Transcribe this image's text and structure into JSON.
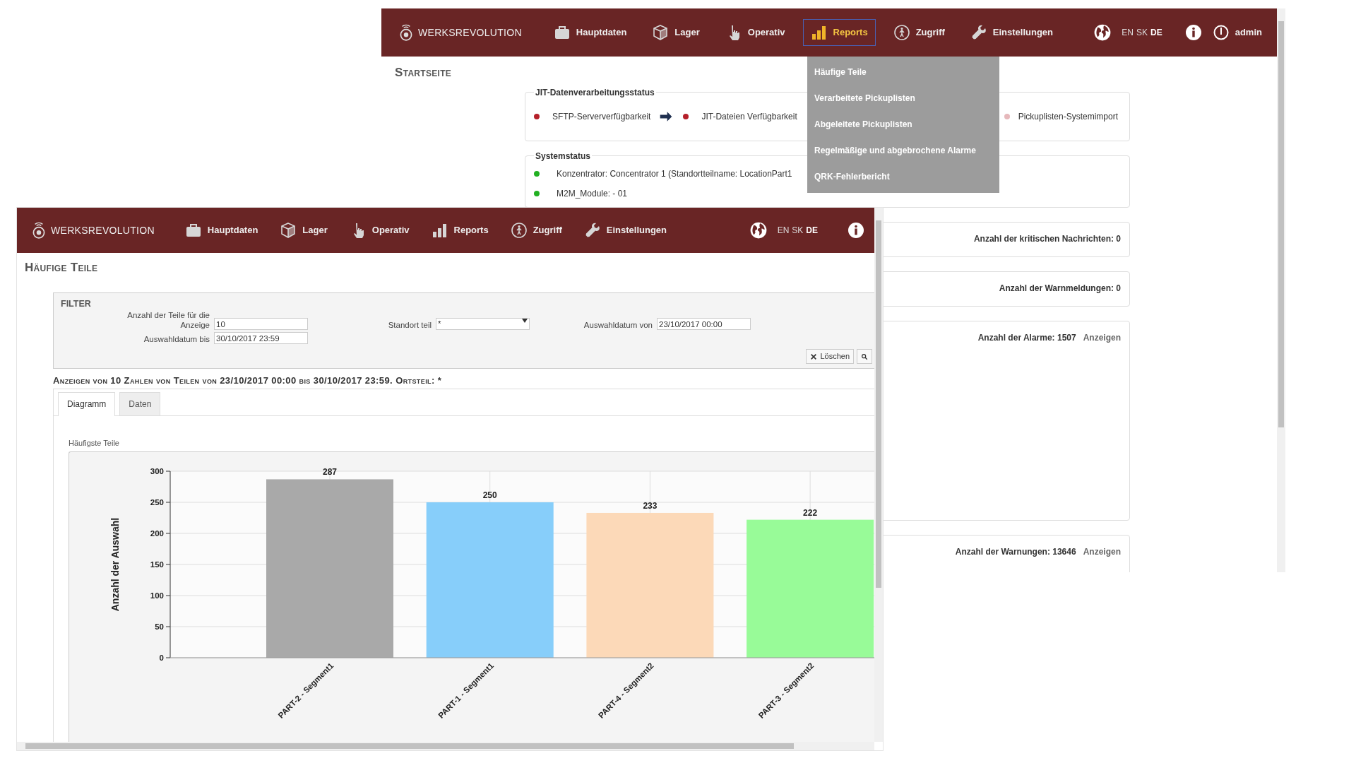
{
  "back_window": {
    "nav": {
      "logo": "WERKSREVOLUTION",
      "items": [
        {
          "label": "Hauptdaten",
          "selected": false
        },
        {
          "label": "Lager",
          "selected": false
        },
        {
          "label": "Operativ",
          "selected": false
        },
        {
          "label": "Reports",
          "selected": true
        },
        {
          "label": "Zugriff",
          "selected": false
        },
        {
          "label": "Einstellungen",
          "selected": false
        }
      ],
      "languages": [
        {
          "label": "EN",
          "selected": false
        },
        {
          "label": "SK",
          "selected": false
        },
        {
          "label": "DE",
          "selected": true
        }
      ],
      "user": "admin"
    },
    "reports_menu": [
      "Häufige Teile",
      "Verarbeitete Pickuplisten",
      "Abgeleitete Pickuplisten",
      "Regelmäßige und abgebrochene Alarme",
      "QRK-Fehlerbericht"
    ],
    "page_title": "Startseite",
    "jit_status": {
      "title": "JIT-Datenverarbeitungsstatus",
      "steps": [
        {
          "label": "SFTP-Serververfügbarkeit",
          "color": "#b5202a"
        },
        {
          "label": "JIT-Dateien Verfügbarkeit",
          "color": "#b5202a"
        },
        {
          "label": "Pickuplisten-Systemimport",
          "color": "#e6b8bb"
        }
      ]
    },
    "system_status": {
      "title": "Systemstatus",
      "items": [
        {
          "label": "Konzentrator: Concentrator 1 (Standortteilname: LocationPart1",
          "color": "#22b022"
        },
        {
          "label": "M2M_Module: - 01",
          "color": "#22b022"
        }
      ]
    },
    "counters": [
      {
        "label": "Anzahl der kritischen Nachrichten: 0"
      },
      {
        "label": "Anzahl der Warnmeldungen: 0"
      },
      {
        "label": "Anzahl der Alarme: 1507",
        "link": "Anzeigen"
      },
      {
        "label": "Anzahl der Warnungen: 13646",
        "link": "Anzeigen"
      }
    ]
  },
  "front_window": {
    "nav": {
      "logo": "WERKSREVOLUTION",
      "items": [
        {
          "label": "Hauptdaten",
          "selected": false
        },
        {
          "label": "Lager",
          "selected": false
        },
        {
          "label": "Operativ",
          "selected": false
        },
        {
          "label": "Reports",
          "selected": false
        },
        {
          "label": "Zugriff",
          "selected": false
        },
        {
          "label": "Einstellungen",
          "selected": false
        }
      ],
      "languages": [
        {
          "label": "EN",
          "selected": false
        },
        {
          "label": "SK",
          "selected": false
        },
        {
          "label": "DE",
          "selected": true
        }
      ]
    },
    "page_title": "Häufige Teile",
    "filter": {
      "title": "FILTER",
      "fields": [
        {
          "label": "Anzahl der Teile für die Anzeige",
          "value": "10",
          "kind": "text"
        },
        {
          "label": "Standort teil",
          "value": "*",
          "kind": "select"
        },
        {
          "label": "Auswahldatum von",
          "value": "23/10/2017 00:00",
          "kind": "text"
        },
        {
          "label": "Auswahldatum bis",
          "value": "30/10/2017 23:59",
          "kind": "text"
        }
      ],
      "clear_button": "Löschen"
    },
    "summary": "Anzeigen von 10 Zahlen von Teilen von 23/10/2017 00:00 bis 30/10/2017 23:59. Ortsteil: *",
    "tabs": [
      {
        "label": "Diagramm",
        "selected": true
      },
      {
        "label": "Daten",
        "selected": false
      }
    ],
    "chart_data": {
      "type": "bar",
      "title": "Häufigste Teile",
      "ylabel": "Anzahl der Auswahl",
      "categories": [
        "PART-2 - Segment1",
        "PART-1 - Segment1",
        "PART-4 - Segment2",
        "PART-3 - Segment2"
      ],
      "series": [
        {
          "values": [
            287,
            250,
            233,
            222
          ]
        }
      ],
      "colors": [
        "#a9a9a9",
        "#87cefa",
        "#fcd9b8",
        "#98fb98"
      ],
      "ylim": [
        0,
        300
      ],
      "yticks": [
        0,
        50,
        100,
        150,
        200,
        250,
        300
      ],
      "data_labels": true,
      "grid": true
    }
  }
}
